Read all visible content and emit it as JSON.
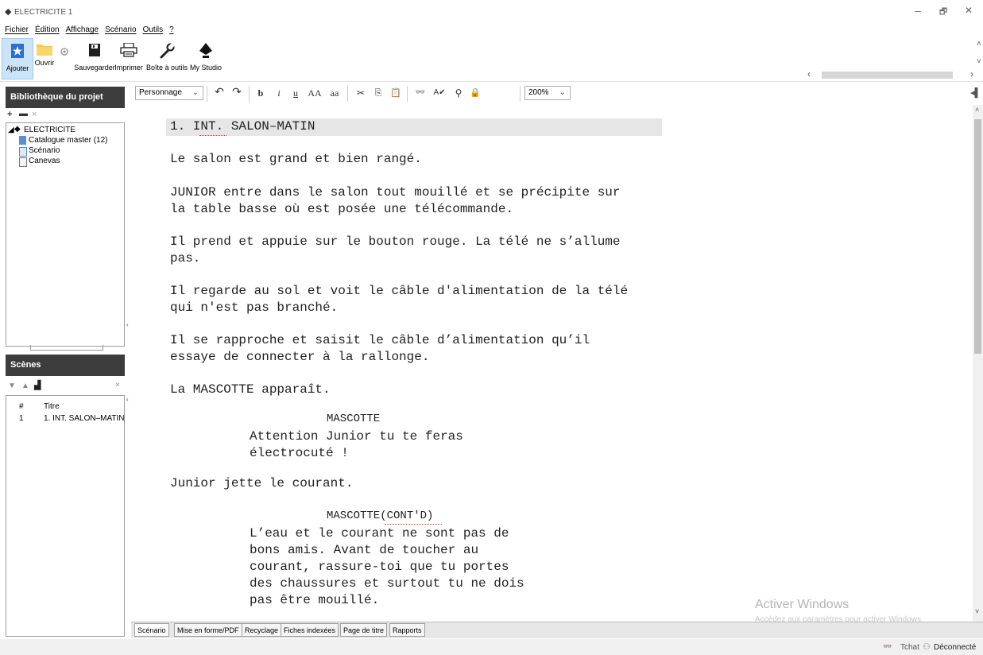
{
  "window": {
    "title": "ELECTRICITE 1",
    "minimize": "–",
    "maximize": "🗗",
    "close": "✕"
  },
  "menu": [
    "Fichier",
    "Édition",
    "Affichage",
    "Scénario",
    "Outils",
    "?"
  ],
  "toolbar": {
    "ajouter": "Ajouter",
    "ouvrir": "Ouvrir",
    "sauvegarder": "Sauvegarder",
    "imprimer": "Imprimer",
    "boite": "Boîte à outils",
    "studio": "My Studio"
  },
  "library": {
    "title": "Bibliothèque du projet",
    "root": "ELECTRICITE",
    "items": [
      "Catalogue master (12)",
      "Scénario",
      "Canevas"
    ]
  },
  "scenes": {
    "title": "Scènes",
    "col_num": "#",
    "col_title": "Titre",
    "rows": [
      {
        "num": "1",
        "title": "1. INT. SALON–MATIN"
      }
    ]
  },
  "editor_toolbar": {
    "style": "Personnage",
    "bold": "b",
    "italic": "i",
    "underline": "u",
    "upper": "AA",
    "lower": "aa",
    "spell": "A✔",
    "zoom": "200%"
  },
  "script": {
    "heading": "1. INT. SALON–MATIN",
    "action1": "Le salon est grand et bien rangé.",
    "action2a": "JUNIOR entre dans le salon tout mouillé et se précipite sur",
    "action2b": "la table basse où est posée une télécommande.",
    "action3a": "Il prend et appuie sur le bouton rouge. La télé ne s’allume",
    "action3b": "pas.",
    "action4a": "Il regarde au sol et voit le câble d'alimentation de la télé",
    "action4b": "qui n'est pas branché.",
    "action5a": "Il se rapproche et saisit le câble d’alimentation qu’il",
    "action5b": "essaye de connecter à la rallonge.",
    "action6": "La MASCOTTE apparaît.",
    "char1": "MASCOTTE",
    "dlg1a": "Attention Junior tu te feras",
    "dlg1b": "électrocuté !",
    "action7": "Junior jette le courant.",
    "char2": "MASCOTTE(CONT'D)",
    "dlg2a": "L’eau et le courant ne sont pas de",
    "dlg2b": "bons amis. Avant de toucher au",
    "dlg2c": "courant, rassure-toi que tu portes",
    "dlg2d": "des chaussures et surtout tu ne dois",
    "dlg2e": "pas être mouillé."
  },
  "tabs": [
    "Scénario",
    "Mise en forme/PDF",
    "Recyclage",
    "Fiches indexées",
    "Page de titre",
    "Rapports"
  ],
  "status": {
    "chat": "Tchat",
    "connection": "Déconnecté"
  },
  "watermark": {
    "line1": "Activer Windows",
    "line2": "Accédez aux paramètres pour activer Windows."
  }
}
